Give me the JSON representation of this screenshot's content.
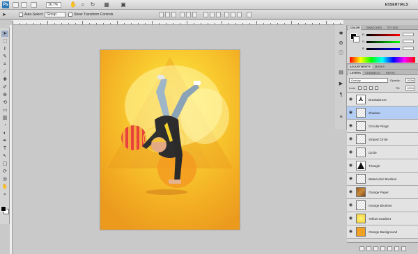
{
  "appbar": {
    "app_icon": "Ps",
    "zoom": "16.7%",
    "workspace": "ESSENTIALS",
    "icons": [
      "hand-icon",
      "zoom-icon",
      "rotate-view-icon",
      "grid-icon",
      "screen-mode-icon"
    ]
  },
  "options": {
    "auto_select_label": "Auto-Select:",
    "auto_select_value": "Group",
    "transform_controls_label": "Show Transform Controls"
  },
  "tools": [
    "move-icon",
    "marquee-icon",
    "lasso-icon",
    "quick-select-icon",
    "crop-icon",
    "eyedropper-icon",
    "healing-icon",
    "brush-icon",
    "clone-icon",
    "history-brush-icon",
    "eraser-icon",
    "gradient-icon",
    "blur-icon",
    "dodge-icon",
    "pen-icon",
    "type-icon",
    "path-select-icon",
    "shape-icon",
    "3d-rotate-icon",
    "3d-orbit-icon",
    "hand-icon",
    "zoom-icon"
  ],
  "colors": {
    "canvas_bg": "#f2a922",
    "highlight": "#fbe230",
    "selected_layer": "#b3cdf5"
  },
  "panels": {
    "color_tabs": [
      "COLOR",
      "SWATCHES",
      "STYLES"
    ],
    "color_channels": [
      "R",
      "G",
      "B"
    ],
    "adjust_tabs": [
      "ADJUSTMENTS",
      "MASKS"
    ],
    "layer_tabs": [
      "LAYERS",
      "CHANNELS",
      "PATHS"
    ],
    "blend_mode": "Overlay",
    "opacity_label": "Opacity:",
    "opacity_value": "100%",
    "lock_label": "Lock:",
    "fill_label": "Fill:",
    "fill_value": "100%"
  },
  "layers": [
    {
      "name": "Breakdancer",
      "thumb": "figure"
    },
    {
      "name": "Shadow",
      "thumb": "checker",
      "selected": true
    },
    {
      "name": "Circular Rings",
      "thumb": "checker"
    },
    {
      "name": "Striped Circle",
      "thumb": "checker"
    },
    {
      "name": "Circle",
      "thumb": "checker"
    },
    {
      "name": "Triangle",
      "thumb": "triangle"
    },
    {
      "name": "Watercolor Brushes",
      "thumb": "checker"
    },
    {
      "name": "Grunge Paper",
      "thumb": "brown"
    },
    {
      "name": "Grunge Brushes",
      "thumb": "checker"
    },
    {
      "name": "Yellow Gradient",
      "thumb": "yellow"
    },
    {
      "name": "Orange Background",
      "thumb": "orange"
    }
  ]
}
